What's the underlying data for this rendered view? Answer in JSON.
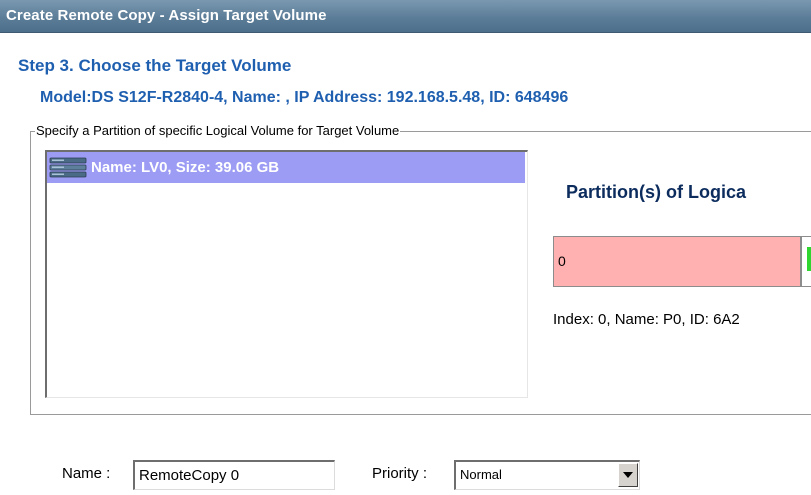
{
  "window": {
    "title": "Create Remote Copy - Assign Target Volume"
  },
  "step": {
    "title": "Step 3. Choose the Target Volume",
    "device_info": "Model:DS S12F-R2840-4, Name: , IP Address: 192.168.5.48, ID: 648496"
  },
  "group": {
    "legend": "Specify a Partition of specific Logical Volume for Target Volume"
  },
  "logical_volumes": [
    {
      "label": "Name: LV0, Size: 39.06 GB",
      "selected": true,
      "icon": "disk-stack-icon"
    }
  ],
  "partitions": {
    "heading": "Partition(s) of Logica",
    "items": [
      {
        "label": "0",
        "color": "#ffb0b0"
      }
    ],
    "indicator_color": "#2fd62f",
    "detail": "Index: 0, Name: P0, ID: 6A2"
  },
  "form": {
    "name_label": "Name :",
    "name_value": "RemoteCopy 0",
    "priority_label": "Priority :",
    "priority_value": "Normal"
  },
  "colors": {
    "heading_blue": "#1f5fb0",
    "selection": "#9c9cf4",
    "partition_fill": "#ffb0b0"
  }
}
